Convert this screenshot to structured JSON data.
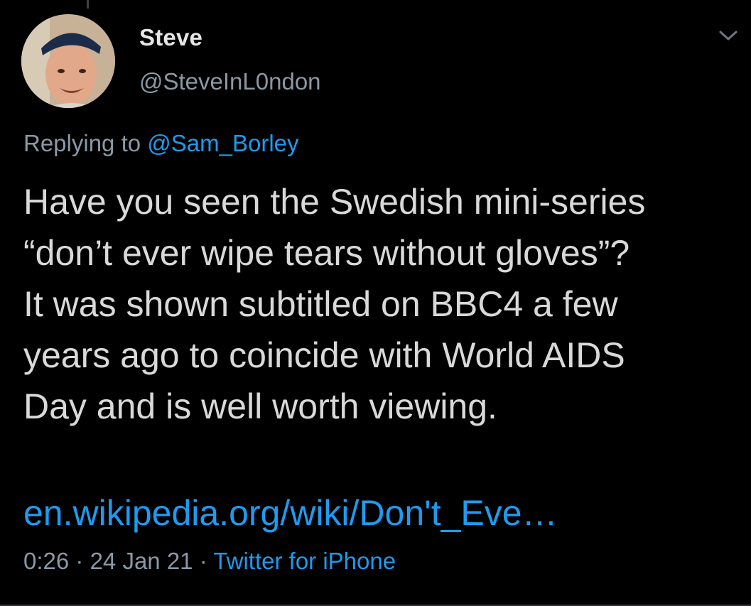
{
  "author": {
    "name": "Steve",
    "handle": "@SteveInL0ndon"
  },
  "reply": {
    "prefix": "Replying to",
    "mention": "@Sam_Borley"
  },
  "tweet": {
    "lines": [
      "Have you seen the Swedish mini-series",
      "“don’t ever wipe tears without gloves”?",
      "It was shown subtitled on BBC4 a few",
      "years ago to coincide with World AIDS",
      "Day and is well worth viewing."
    ],
    "link": "en.wikipedia.org/wiki/Don't_Eve…"
  },
  "meta": {
    "time": "0:26",
    "sep1": "·",
    "date": "24 Jan 21",
    "sep2": "·",
    "source": "Twitter for iPhone"
  },
  "colors": {
    "background": "#000000",
    "text": "#d9d9d9",
    "secondary": "#8b98a5",
    "accent": "#1d9bf0"
  },
  "icons": {
    "menu": "chevron-down-icon",
    "avatar": "profile-photo"
  }
}
